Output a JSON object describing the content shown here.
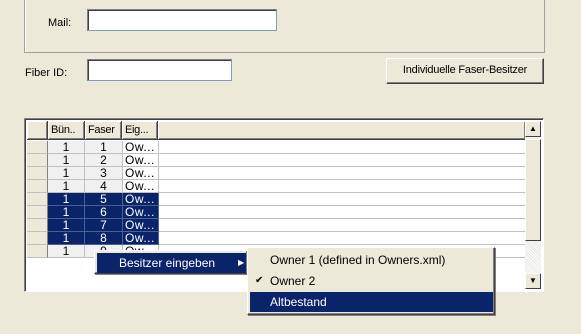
{
  "mail": {
    "label": "Mail:",
    "value": ""
  },
  "fiber": {
    "label": "Fiber ID:",
    "value": ""
  },
  "owner_button": {
    "label": "Individuelle Faser-Besitzer"
  },
  "grid": {
    "headers": [
      "Bün..",
      "Faser",
      "Eig..."
    ],
    "rows": [
      {
        "buendel": "1",
        "faser": "1",
        "eig": "Ow...",
        "selected": false
      },
      {
        "buendel": "1",
        "faser": "2",
        "eig": "Ow...",
        "selected": false
      },
      {
        "buendel": "1",
        "faser": "3",
        "eig": "Ow...",
        "selected": false
      },
      {
        "buendel": "1",
        "faser": "4",
        "eig": "Ow...",
        "selected": false
      },
      {
        "buendel": "1",
        "faser": "5",
        "eig": "Ow...",
        "selected": true
      },
      {
        "buendel": "1",
        "faser": "6",
        "eig": "Ow...",
        "selected": true
      },
      {
        "buendel": "1",
        "faser": "7",
        "eig": "Ow...",
        "selected": true
      },
      {
        "buendel": "1",
        "faser": "8",
        "eig": "Ow...",
        "selected": true
      },
      {
        "buendel": "1",
        "faser": "9",
        "eig": "Ow",
        "selected": false
      }
    ]
  },
  "context_menu": {
    "item": "Besitzer eingeben",
    "arrow": "▶"
  },
  "submenu": {
    "items": [
      {
        "label": "Owner 1 (defined in Owners.xml)",
        "checked": false,
        "highlighted": false
      },
      {
        "label": "Owner 2",
        "checked": true,
        "highlighted": false
      },
      {
        "label": "Altbestand",
        "checked": false,
        "highlighted": true
      }
    ],
    "check_glyph": "✔"
  },
  "icons": {
    "scroll_up": "▲",
    "scroll_down": "▼"
  }
}
